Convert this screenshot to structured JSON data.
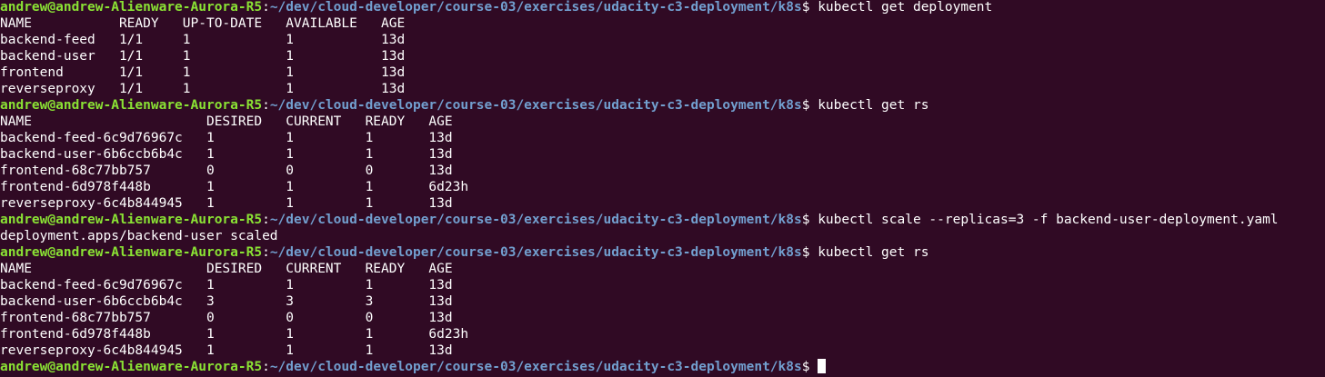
{
  "terminal": {
    "user_host": "andrew@andrew-Alienware-Aurora-R5",
    "separator": ":",
    "cwd": "~/dev/cloud-developer/course-03/exercises/udacity-c3-deployment/k8s",
    "prompt_symbol": "$ ",
    "colors": {
      "background": "#300a24",
      "prompt_user": "#8ae234",
      "prompt_path": "#729fcf",
      "text": "#ffffff"
    },
    "lines": [
      {
        "type": "prompt",
        "command": "kubectl get deployment"
      },
      {
        "type": "output",
        "text": "NAME           READY   UP-TO-DATE   AVAILABLE   AGE"
      },
      {
        "type": "output",
        "text": "backend-feed   1/1     1            1           13d"
      },
      {
        "type": "output",
        "text": "backend-user   1/1     1            1           13d"
      },
      {
        "type": "output",
        "text": "frontend       1/1     1            1           13d"
      },
      {
        "type": "output",
        "text": "reverseproxy   1/1     1            1           13d"
      },
      {
        "type": "prompt",
        "command": "kubectl get rs"
      },
      {
        "type": "output",
        "text": "NAME                      DESIRED   CURRENT   READY   AGE"
      },
      {
        "type": "output",
        "text": "backend-feed-6c9d76967c   1         1         1       13d"
      },
      {
        "type": "output",
        "text": "backend-user-6b6ccb6b4c   1         1         1       13d"
      },
      {
        "type": "output",
        "text": "frontend-68c77bb757       0         0         0       13d"
      },
      {
        "type": "output",
        "text": "frontend-6d978f448b       1         1         1       6d23h"
      },
      {
        "type": "output",
        "text": "reverseproxy-6c4b844945   1         1         1       13d"
      },
      {
        "type": "prompt",
        "command": "kubectl scale --replicas=3 -f backend-user-deployment.yaml"
      },
      {
        "type": "output",
        "text": "deployment.apps/backend-user scaled"
      },
      {
        "type": "prompt",
        "command": "kubectl get rs"
      },
      {
        "type": "output",
        "text": "NAME                      DESIRED   CURRENT   READY   AGE"
      },
      {
        "type": "output",
        "text": "backend-feed-6c9d76967c   1         1         1       13d"
      },
      {
        "type": "output",
        "text": "backend-user-6b6ccb6b4c   3         3         3       13d"
      },
      {
        "type": "output",
        "text": "frontend-68c77bb757       0         0         0       13d"
      },
      {
        "type": "output",
        "text": "frontend-6d978f448b       1         1         1       6d23h"
      },
      {
        "type": "output",
        "text": "reverseproxy-6c4b844945   1         1         1       13d"
      },
      {
        "type": "prompt",
        "command": "",
        "cursor": true
      }
    ]
  }
}
